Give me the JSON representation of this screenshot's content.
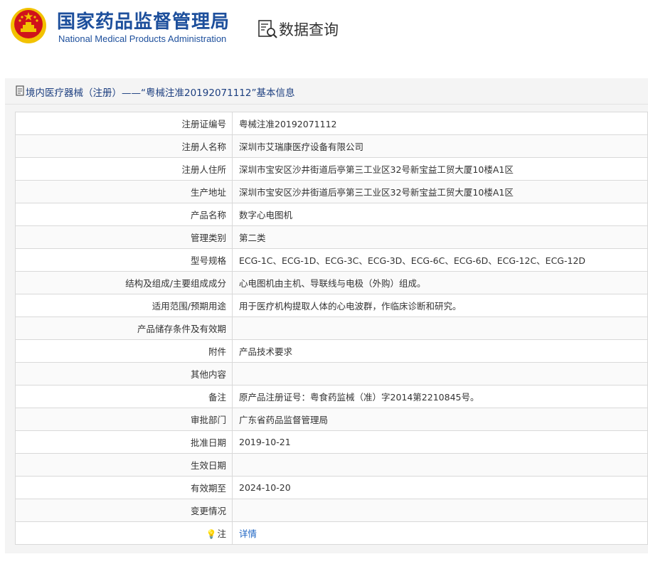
{
  "header": {
    "org_name_cn": "国家药品监督管理局",
    "org_name_en": "National Medical Products Administration",
    "query_title": "数据查询",
    "emblem_icon": "national-emblem-icon",
    "query_icon": "document-search-icon"
  },
  "panel": {
    "title": "境内医疗器械（注册）——“粤械注准20192071112”基本信息"
  },
  "rows": [
    {
      "label": "注册证编号",
      "value": "粤械注准20192071112"
    },
    {
      "label": "注册人名称",
      "value": "深圳市艾瑞康医疗设备有限公司"
    },
    {
      "label": "注册人住所",
      "value": "深圳市宝安区沙井街道后亭第三工业区32号新宝益工贸大厦10楼A1区"
    },
    {
      "label": "生产地址",
      "value": "深圳市宝安区沙井街道后亭第三工业区32号新宝益工贸大厦10楼A1区"
    },
    {
      "label": "产品名称",
      "value": "数字心电图机"
    },
    {
      "label": "管理类别",
      "value": "第二类"
    },
    {
      "label": "型号规格",
      "value": "ECG-1C、ECG-1D、ECG-3C、ECG-3D、ECG-6C、ECG-6D、ECG-12C、ECG-12D"
    },
    {
      "label": "结构及组成/主要组成成分",
      "value": "心电图机由主机、导联线与电极（外购）组成。"
    },
    {
      "label": "适用范围/预期用途",
      "value": "用于医疗机构提取人体的心电波群，作临床诊断和研究。"
    },
    {
      "label": "产品储存条件及有效期",
      "value": ""
    },
    {
      "label": "附件",
      "value": "产品技术要求"
    },
    {
      "label": "其他内容",
      "value": ""
    },
    {
      "label": "备注",
      "value": "原产品注册证号：粤食药监械（准）字2014第2210845号。"
    },
    {
      "label": "审批部门",
      "value": "广东省药品监督管理局"
    },
    {
      "label": "批准日期",
      "value": "2019-10-21"
    },
    {
      "label": "生效日期",
      "value": ""
    },
    {
      "label": "有效期至",
      "value": "2024-10-20"
    },
    {
      "label": "变更情况",
      "value": ""
    }
  ],
  "note_row": {
    "label": "注",
    "icon": "lightbulb-icon",
    "link_text": "详情"
  },
  "colors": {
    "brand_blue": "#1d4f9c",
    "link_blue": "#1d64c3",
    "emblem_red": "#d0121b",
    "emblem_gold": "#f2c200"
  }
}
